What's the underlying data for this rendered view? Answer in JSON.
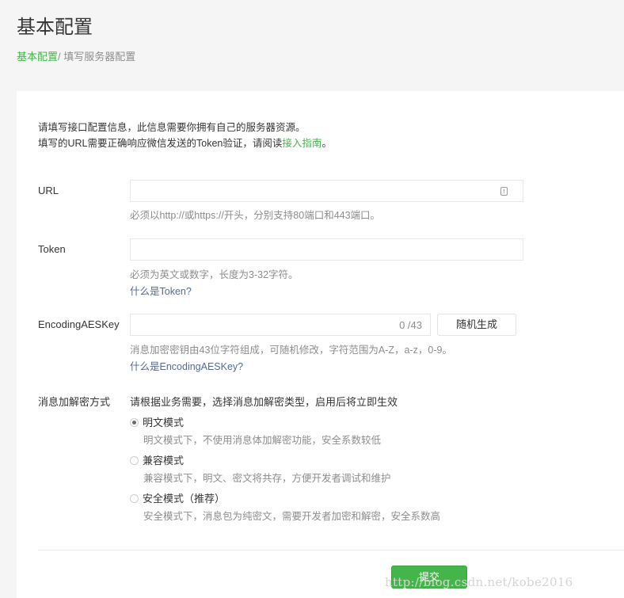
{
  "header": {
    "title": "基本配置",
    "breadcrumb_link": "基本配置",
    "breadcrumb_separator": "/ ",
    "breadcrumb_current": "填写服务器配置"
  },
  "intro": {
    "line1": "请填写接口配置信息，此信息需要你拥有自己的服务器资源。",
    "line2_prefix": "填写的URL需要正确响应微信发送的Token验证，请阅读",
    "line2_link": "接入指南",
    "line2_suffix": "。"
  },
  "url": {
    "label": "URL",
    "value": "",
    "hint": "必须以http://或https://开头，分别支持80端口和443端口。"
  },
  "token": {
    "label": "Token",
    "value": "",
    "hint": "必须为英文或数字，长度为3-32字符。",
    "help_link": "什么是Token?"
  },
  "aes": {
    "label": "EncodingAESKey",
    "value": "",
    "counter": "0 /43",
    "random_button": "随机生成",
    "hint": "消息加密密钥由43位字符组成，可随机修改，字符范围为A-Z，a-z，0-9。",
    "help_link": "什么是EncodingAESKey?"
  },
  "encryption": {
    "label": "消息加解密方式",
    "description": "请根据业务需要，选择消息加解密类型，启用后将立即生效",
    "options": [
      {
        "label": "明文模式",
        "desc": "明文模式下，不使用消息体加解密功能，安全系数较低",
        "checked": true
      },
      {
        "label": "兼容模式",
        "desc": "兼容模式下，明文、密文将共存，方便开发者调试和维护",
        "checked": false
      },
      {
        "label": "安全模式（推荐）",
        "desc": "安全模式下，消息包为纯密文，需要开发者加密和解密，安全系数高",
        "checked": false
      }
    ]
  },
  "submit_button": "提交",
  "watermark": "http://blog.csdn.net/kobe2016",
  "colors": {
    "accent": "#44b549",
    "link": "#576b95",
    "hint": "#8d8d8d"
  }
}
